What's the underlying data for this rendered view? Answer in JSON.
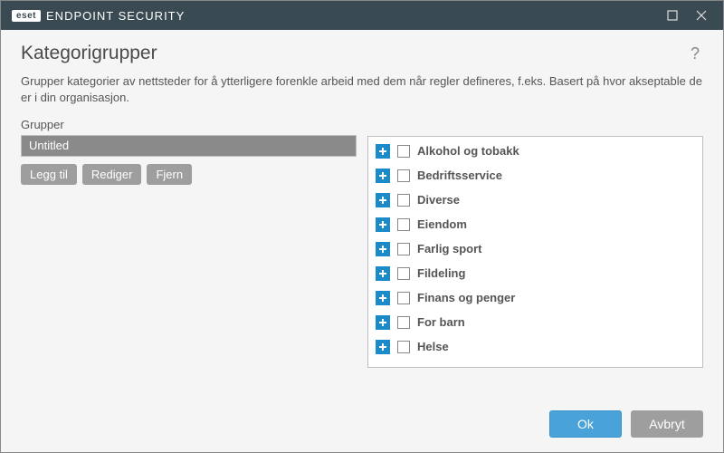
{
  "titlebar": {
    "brand_logo": "eset",
    "brand_text": "ENDPOINT SECURITY"
  },
  "page": {
    "title": "Kategorigrupper",
    "description": "Grupper kategorier av nettsteder for å ytterligere forenkle arbeid med dem når regler defineres, f.eks. Basert på hvor akseptable de er i din organisasjon."
  },
  "groups": {
    "label": "Grupper",
    "items": [
      {
        "label": "Untitled",
        "selected": true
      }
    ],
    "buttons": {
      "add": "Legg til",
      "edit": "Rediger",
      "remove": "Fjern"
    }
  },
  "categories": {
    "items": [
      {
        "label": "Alkohol og tobakk"
      },
      {
        "label": "Bedriftsservice"
      },
      {
        "label": "Diverse"
      },
      {
        "label": "Eiendom"
      },
      {
        "label": "Farlig sport"
      },
      {
        "label": "Fildeling"
      },
      {
        "label": "Finans og penger"
      },
      {
        "label": "For barn"
      },
      {
        "label": "Helse"
      }
    ]
  },
  "footer": {
    "ok": "Ok",
    "cancel": "Avbryt"
  }
}
